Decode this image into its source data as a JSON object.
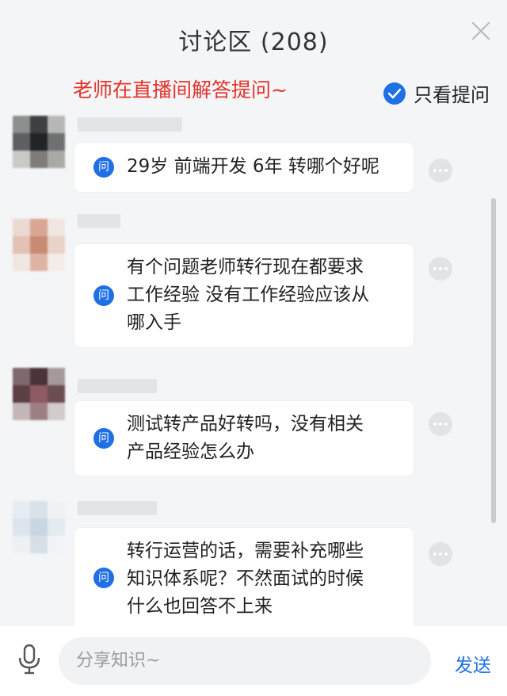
{
  "header": {
    "title": "讨论区 (208)"
  },
  "notice": "老师在直播间解答提问~",
  "filter": {
    "only_questions_label": "只看提问",
    "checked": true
  },
  "question_badge": "问",
  "questions": [
    {
      "text": "29岁 前端开发 6年 转哪个好呢"
    },
    {
      "text": "有个问题老师转行现在都要求\n工作经验 没有工作经验应该从\n哪入手"
    },
    {
      "text": "测试转产品好转吗，没有相关\n产品经验怎么办"
    },
    {
      "text": "转行运营的话，需要补充哪些\n知识体系呢？不然面试的时候\n什么也回答不上来"
    }
  ],
  "composer": {
    "placeholder": "分享知识~",
    "send_label": "发送"
  },
  "colors": {
    "accent": "#1f6fe5",
    "notice": "#e3322b",
    "background": "#f4f5f7"
  },
  "icons": [
    "close-icon",
    "check-circle-icon",
    "question-badge-icon",
    "more-options-icon",
    "microphone-icon"
  ]
}
